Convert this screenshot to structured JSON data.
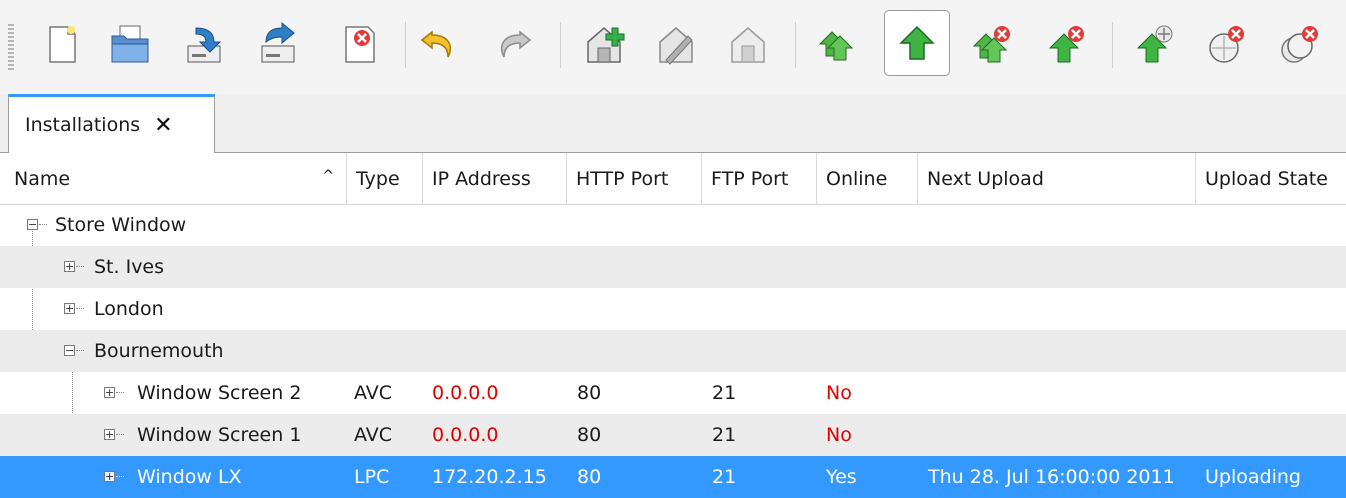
{
  "toolbar": {
    "icons": [
      "new-file-icon",
      "open-folder-icon",
      "import-icon",
      "export-icon",
      "delete-file-icon",
      "undo-icon",
      "redo-icon",
      "add-installation-icon",
      "edit-installation-icon",
      "installation-icon",
      "upload-all-icon",
      "upload-icon",
      "cancel-upload-all-icon",
      "cancel-upload-icon",
      "remote-upload-icon",
      "cancel-remote-icon",
      "cancel-remote-all-icon"
    ]
  },
  "tabs": [
    {
      "label": "Installations",
      "close_glyph": "✕"
    }
  ],
  "columns": [
    "Name",
    "Type",
    "IP Address",
    "HTTP Port",
    "FTP Port",
    "Online",
    "Next Upload",
    "Upload State"
  ],
  "sort_glyph": "^",
  "rows": [
    {
      "name": "Store Window",
      "expander": "−"
    },
    {
      "name": "St. Ives",
      "expander": "+"
    },
    {
      "name": "London",
      "expander": "+"
    },
    {
      "name": "Bournemouth",
      "expander": "−"
    },
    {
      "name": "Window Screen 2",
      "expander": "+",
      "type": "AVC",
      "ip": "0.0.0.0",
      "http": "80",
      "ftp": "21",
      "online": "No",
      "next": "",
      "state": ""
    },
    {
      "name": "Window Screen 1",
      "expander": "+",
      "type": "AVC",
      "ip": "0.0.0.0",
      "http": "80",
      "ftp": "21",
      "online": "No",
      "next": "",
      "state": ""
    },
    {
      "name": "Window LX",
      "expander": "+",
      "type": "LPC",
      "ip": "172.20.2.15",
      "http": "80",
      "ftp": "21",
      "online": "Yes",
      "next": "Thu 28. Jul 16:00:00 2011",
      "state": "Uploading"
    }
  ],
  "colors": {
    "selection": "#3399ff",
    "offline": "#e00000",
    "tab_accent": "#3399ff"
  }
}
